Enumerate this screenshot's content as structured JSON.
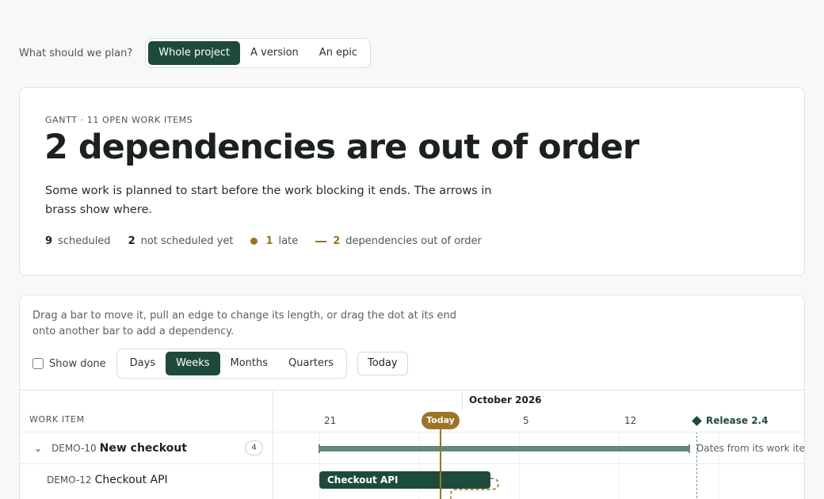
{
  "scope": {
    "label": "What should we plan?",
    "options": [
      "Whole project",
      "A version",
      "An epic"
    ],
    "selected": "Whole project"
  },
  "summary": {
    "eyebrow": "GANTT · 11 OPEN WORK ITEMS",
    "headline": "2 dependencies are out of order",
    "description": "Some work is planned to start before the work blocking it ends. The arrows in brass show where.",
    "stats": {
      "scheduled": {
        "count": "9",
        "label": "scheduled"
      },
      "not_scheduled": {
        "count": "2",
        "label": "not scheduled yet"
      },
      "late": {
        "count": "1",
        "label": "late"
      },
      "out_of_order": {
        "count": "2",
        "label": "dependencies out of order"
      }
    }
  },
  "gantt": {
    "hint": "Drag a bar to move it, pull an edge to change its length, or drag the dot at its end onto another bar to add a dependency.",
    "show_done_label": "Show done",
    "show_done_checked": false,
    "zoom_options": [
      "Days",
      "Weeks",
      "Months",
      "Quarters"
    ],
    "zoom_selected": "Weeks",
    "today_button": "Today",
    "work_item_header": "WORK ITEM",
    "month_label": "October 2026",
    "ticks": [
      "21",
      "5",
      "12"
    ],
    "today_marker": "Today",
    "release_label": "Release 2.4",
    "rows": [
      {
        "key": "DEMO-10",
        "title": "New checkout",
        "children_count": "4",
        "note": "Dates from its work items"
      },
      {
        "key": "DEMO-12",
        "title": "Checkout API",
        "bar_label": "Checkout API"
      }
    ]
  },
  "colors": {
    "accent": "#1e4a3e",
    "brass": "#9a7428",
    "rollup": "#5e8a7c"
  }
}
